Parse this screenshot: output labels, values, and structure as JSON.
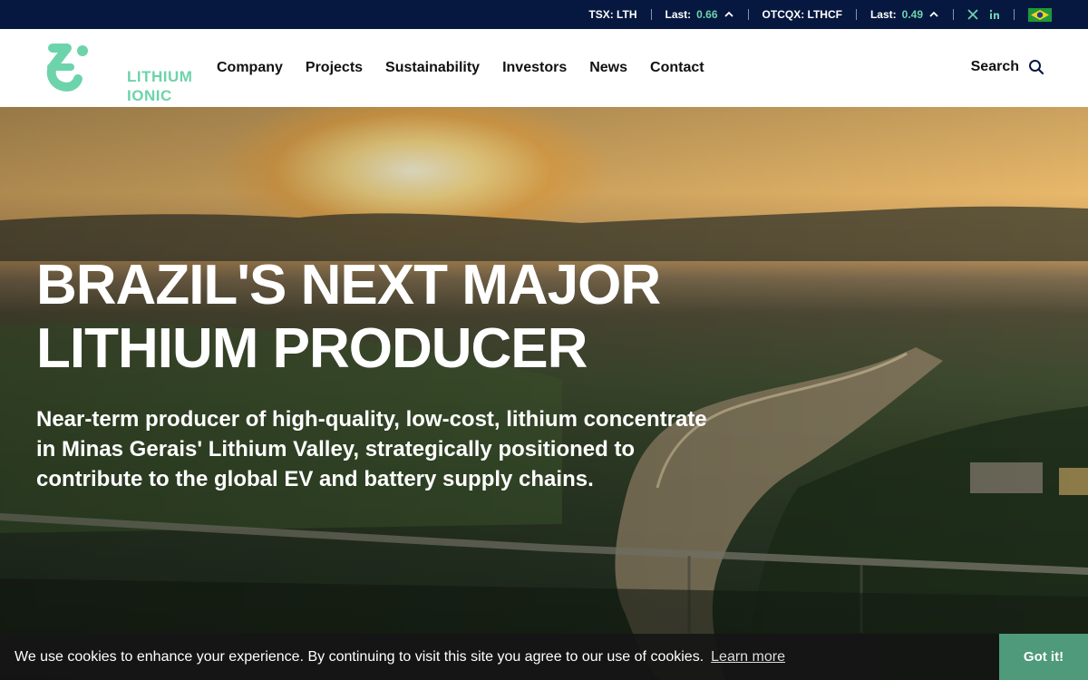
{
  "ticker": {
    "tsx_label": "TSX: LTH",
    "tsx_last_label": "Last:",
    "tsx_last_value": "0.66",
    "otcqx_label": "OTCQX: LTHCF",
    "otcqx_last_label": "Last:",
    "otcqx_last_value": "0.49",
    "social": [
      "x-icon",
      "linkedin-icon"
    ],
    "language_flag": "brazil-flag-icon"
  },
  "brand": {
    "line1": "LITHIUM",
    "line2": "IONIC",
    "color": "#6dd3ab"
  },
  "nav": {
    "items": [
      "Company",
      "Projects",
      "Sustainability",
      "Investors",
      "News",
      "Contact"
    ],
    "search_label": "Search"
  },
  "hero": {
    "title_line1": "BRAZIL'S NEXT MAJOR",
    "title_line2": "LITHIUM PRODUCER",
    "subtitle": "Near-term producer of high-quality, low-cost, lithium concentrate in Minas Gerais' Lithium Valley, strategically positioned to contribute to the global EV and battery supply chains."
  },
  "cookie": {
    "message": "We use cookies to enhance your experience. By continuing to visit this site you agree to our use of cookies.",
    "learn_more": "Learn more",
    "accept": "Got it!"
  },
  "colors": {
    "ticker_bg": "#06183f",
    "accent": "#6dd3ab",
    "cookie_button": "#4e9a7a"
  }
}
